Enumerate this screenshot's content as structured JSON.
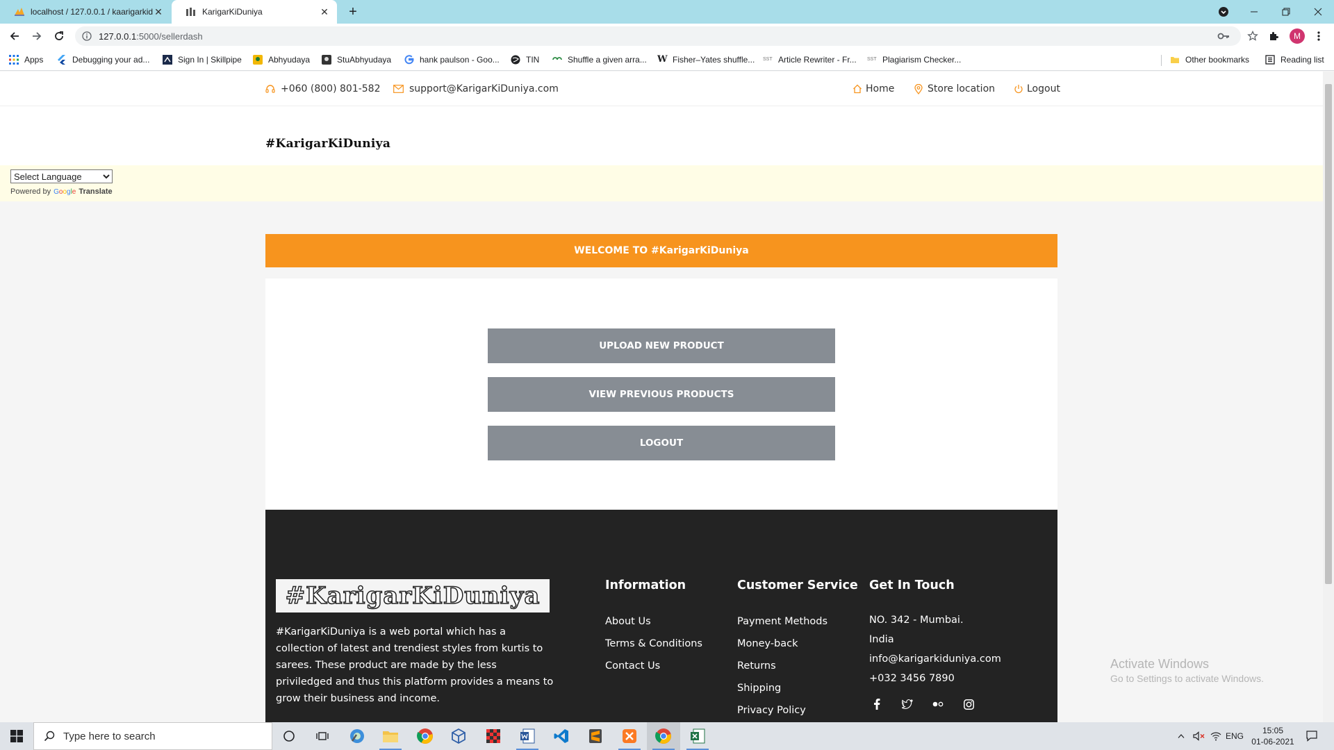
{
  "browser": {
    "tabs": [
      {
        "title": "localhost / 127.0.0.1 / kaarigarkid",
        "active": false
      },
      {
        "title": "KarigarKiDuniya",
        "active": true
      }
    ],
    "url_host": "127.0.0.1",
    "url_path": ":5000/sellerdash",
    "profile_initial": "M",
    "bookmarks": [
      {
        "label": "Apps",
        "icon": "apps-grid-icon"
      },
      {
        "label": "Debugging your ad...",
        "icon": "flutter-icon"
      },
      {
        "label": "Sign In | Skillpipe",
        "icon": "skillpipe-icon"
      },
      {
        "label": "Abhyudaya",
        "icon": "abhyudaya-icon"
      },
      {
        "label": "StuAbhyudaya",
        "icon": "stuabhyudaya-icon"
      },
      {
        "label": "hank paulson - Goo...",
        "icon": "google-icon"
      },
      {
        "label": "TIN",
        "icon": "globe-icon"
      },
      {
        "label": "Shuffle a given arra...",
        "icon": "gfg-icon"
      },
      {
        "label": "Fisher–Yates shuffle...",
        "icon": "wikipedia-icon"
      },
      {
        "label": "Article Rewriter - Fr...",
        "icon": "sst-icon"
      },
      {
        "label": "Plagiarism Checker...",
        "icon": "sst-icon"
      }
    ],
    "other_bookmarks": "Other bookmarks",
    "reading_list": "Reading list"
  },
  "topbar": {
    "phone": "+060 (800) 801-582",
    "email": "support@KarigarKiDuniya.com",
    "nav": [
      "Home",
      "Store location",
      "Logout"
    ]
  },
  "header": {
    "brand": "#KarigarKiDuniya"
  },
  "translate": {
    "select_label": "Select Language",
    "powered_by": "Powered by",
    "google": "Google",
    "translate": "Translate"
  },
  "welcome": "WELCOME TO #KarigarKiDuniya",
  "actions": {
    "upload": "UPLOAD NEW PRODUCT",
    "view": "VIEW PREVIOUS PRODUCTS",
    "logout": "LOGOUT"
  },
  "footer": {
    "logo_text": "#KarigarKiDuniya",
    "description": "#KarigarKiDuniya is a web portal which has a collection of latest and trendiest styles from kurtis to sarees. These product are made by the less priviledged and thus this platform provides a means to grow their business and income.",
    "information": {
      "title": "Information",
      "links": [
        "About Us",
        "Terms & Conditions",
        "Contact Us"
      ]
    },
    "customer_service": {
      "title": "Customer Service",
      "links": [
        "Payment Methods",
        "Money-back",
        "Returns",
        "Shipping",
        "Privacy Policy"
      ]
    },
    "get_in_touch": {
      "title": "Get In Touch",
      "lines": [
        "NO. 342 - Mumbai.",
        "India",
        "info@karigarkiduniya.com",
        "+032 3456 7890"
      ]
    },
    "socials": [
      "facebook-icon",
      "twitter-icon",
      "flickr-icon",
      "instagram-icon"
    ]
  },
  "watermark": {
    "title": "Activate Windows",
    "subtitle": "Go to Settings to activate Windows."
  },
  "taskbar": {
    "search_placeholder": "Type here to search",
    "language": "ENG",
    "time": "15:05",
    "date": "01-06-2021"
  }
}
